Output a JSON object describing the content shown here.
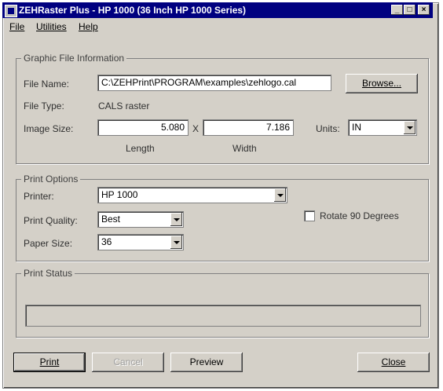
{
  "window": {
    "title": "ZEHRaster Plus - HP 1000 (36 Inch HP 1000 Series)",
    "controls": {
      "minimize": "_",
      "maximize": "□",
      "close": "×"
    }
  },
  "menubar": {
    "items": [
      {
        "label": "File"
      },
      {
        "label": "Utilities"
      },
      {
        "label": "Help"
      }
    ]
  },
  "graphic_file": {
    "legend": "Graphic File Information",
    "file_name_label": "File Name:",
    "file_name_value": "C:\\ZEHPrint\\PROGRAM\\examples\\zehlogo.cal",
    "browse_button": "Browse...",
    "file_type_label": "File Type:",
    "file_type_value": "CALS raster",
    "image_size_label": "Image Size:",
    "length_value": "5.080",
    "times": "X",
    "width_value": "7.186",
    "units_label": "Units:",
    "units_value": "IN",
    "length_caption": "Length",
    "width_caption": "Width"
  },
  "print_options": {
    "legend": "Print Options",
    "printer_label": "Printer:",
    "printer_value": "HP 1000",
    "quality_label": "Print Quality:",
    "quality_value": "Best",
    "paper_label": "Paper Size:",
    "paper_value": "36",
    "rotate_label": "Rotate 90 Degrees",
    "rotate_checked": false
  },
  "print_status": {
    "legend": "Print Status",
    "progress": 0
  },
  "buttons": {
    "print": "Print",
    "cancel": "Cancel",
    "preview": "Preview",
    "close": "Close"
  }
}
